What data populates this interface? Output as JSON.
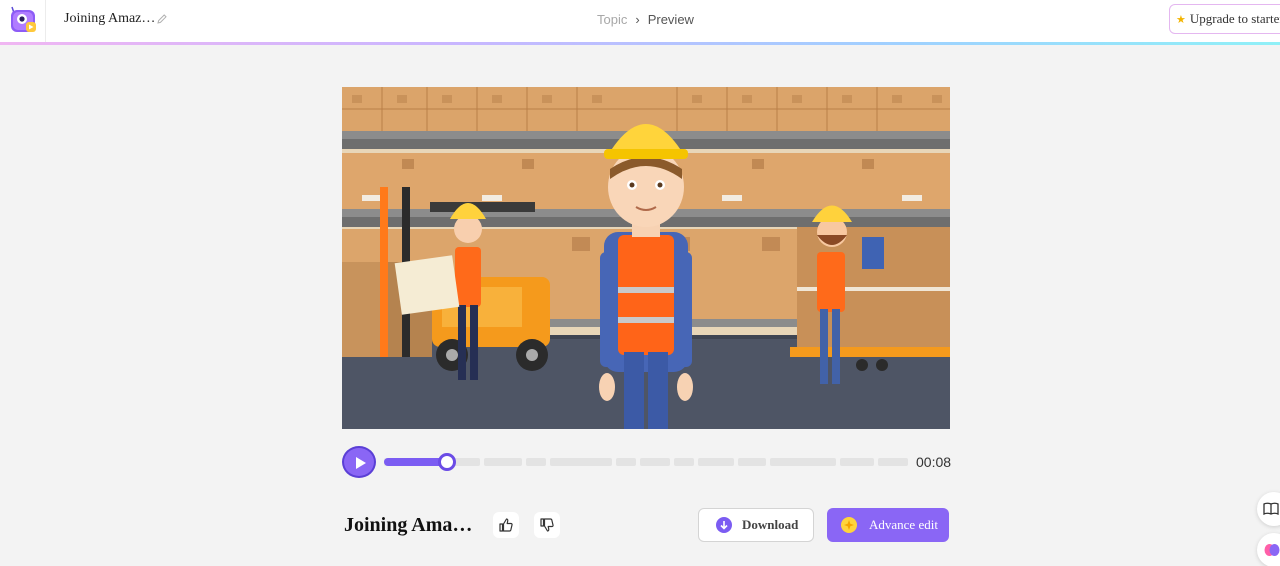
{
  "header": {
    "project_title": "Joining Amaz…",
    "breadcrumb": {
      "topic": "Topic",
      "separator": "›",
      "current": "Preview"
    },
    "upgrade_label": "Upgrade to starter"
  },
  "player": {
    "current_time": "00:08",
    "progress_fraction": 0.12
  },
  "actions": {
    "video_title": "Joining Ama…",
    "download_label": "Download",
    "advance_edit_label": "Advance edit"
  },
  "colors": {
    "accent": "#8a66f5",
    "accent_dark": "#5b3fd6",
    "star": "#ffd43b"
  },
  "icons": [
    "app-logo-icon",
    "pencil-icon",
    "star-icon",
    "play-icon",
    "thumbs-up-icon",
    "thumbs-down-icon",
    "download-icon",
    "sparkle-icon",
    "book-icon",
    "brain-icon"
  ]
}
